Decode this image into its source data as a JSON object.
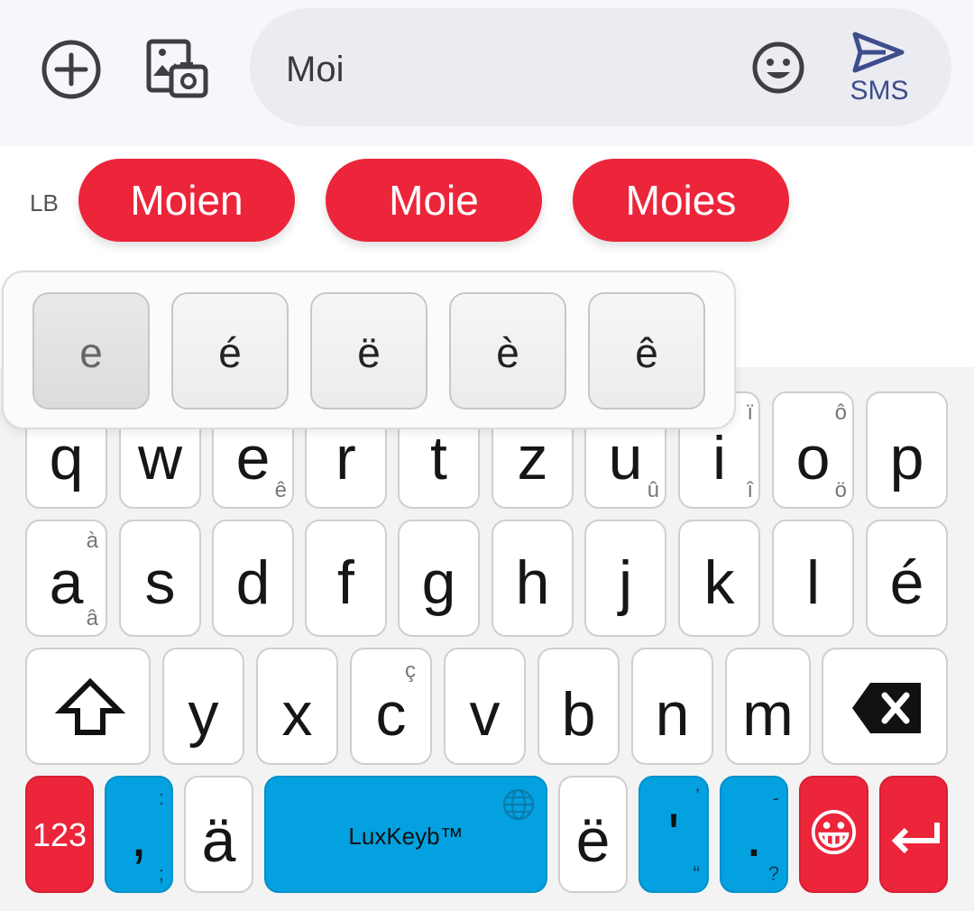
{
  "compose": {
    "message_text": "Moi",
    "send_label": "SMS",
    "icons": {
      "add": "add-circle-icon",
      "media": "gallery-camera-icon",
      "emoji": "emoji-smile-icon",
      "send": "send-icon"
    }
  },
  "suggestions": {
    "language": "LB",
    "items": [
      "Moien",
      "Moie",
      "Moies"
    ]
  },
  "popup": {
    "options": [
      "e",
      "é",
      "ë",
      "è",
      "ê"
    ],
    "selected": "e"
  },
  "keyboard": {
    "row1": [
      {
        "key": "q"
      },
      {
        "key": "w"
      },
      {
        "key": "e",
        "hint_bottom": "ê"
      },
      {
        "key": "r"
      },
      {
        "key": "t"
      },
      {
        "key": "z"
      },
      {
        "key": "u",
        "hint_bottom": "û"
      },
      {
        "key": "i",
        "hint_top": "ï",
        "hint_bottom": "î"
      },
      {
        "key": "o",
        "hint_top": "ô",
        "hint_bottom": "ö"
      },
      {
        "key": "p"
      }
    ],
    "row2": [
      {
        "key": "a",
        "hint_top": "à",
        "hint_bottom": "â"
      },
      {
        "key": "s"
      },
      {
        "key": "d"
      },
      {
        "key": "f"
      },
      {
        "key": "g"
      },
      {
        "key": "h"
      },
      {
        "key": "j"
      },
      {
        "key": "k"
      },
      {
        "key": "l"
      },
      {
        "key": "é"
      }
    ],
    "row3": [
      {
        "key": "y"
      },
      {
        "key": "x"
      },
      {
        "key": "c",
        "hint_top": "ç"
      },
      {
        "key": "v"
      },
      {
        "key": "b"
      },
      {
        "key": "n"
      },
      {
        "key": "m"
      }
    ],
    "row4": {
      "numbers": "123",
      "comma": ",",
      "comma_hint_top": ":",
      "comma_hint_bottom": ";",
      "a_umlaut": "ä",
      "space": "LuxKeyb™",
      "e_umlaut": "ë",
      "apostrophe": "'",
      "apostrophe_hint_top": "’",
      "apostrophe_hint_bottom": "“",
      "period": ".",
      "period_hint_top": "-",
      "period_hint_bottom": "?",
      "emoji": "😀"
    },
    "colors": {
      "accent_red": "#ec253b",
      "accent_blue": "#03a1e0"
    }
  }
}
